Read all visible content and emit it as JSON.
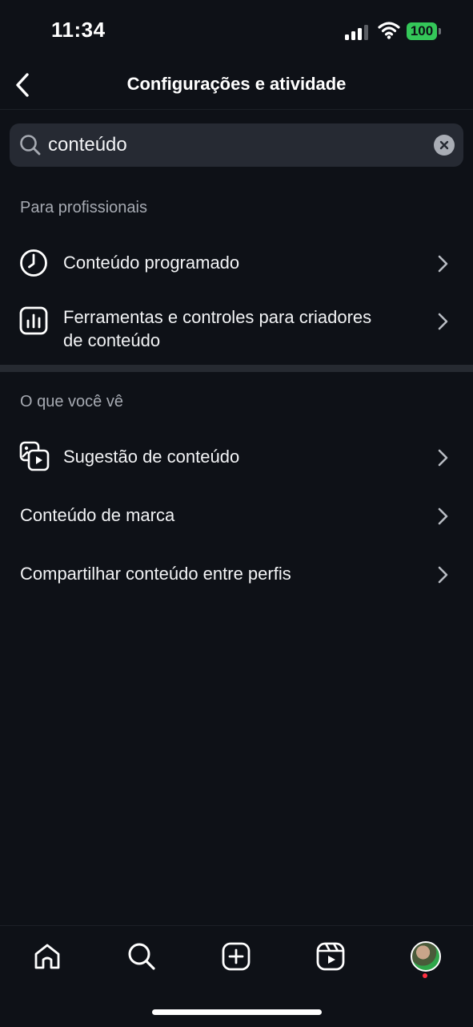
{
  "status_bar": {
    "time": "11:34",
    "battery": "100",
    "battery_color": "#34c759"
  },
  "header": {
    "title": "Configurações e atividade",
    "back_icon": "chevron-left-icon"
  },
  "search": {
    "value": "conteúdo",
    "icon": "search-icon",
    "clear_icon": "clear-icon"
  },
  "sections": {
    "professionals": {
      "title": "Para profissionais",
      "items": [
        {
          "label": "Conteúdo programado",
          "icon": "clock-icon"
        },
        {
          "label_line1": "Ferramentas e controles para criadores",
          "label_line2": "de conteúdo",
          "icon": "bar-chart-icon"
        }
      ]
    },
    "what_you_see": {
      "title": "O que você vê",
      "items": [
        {
          "label": "Sugestão de conteúdo",
          "icon": "media-suggestions-icon"
        },
        {
          "label": "Conteúdo de marca"
        },
        {
          "label": "Compartilhar conteúdo entre perfis"
        }
      ]
    }
  },
  "bottom_nav": {
    "items": [
      "home-icon",
      "search-icon",
      "create-icon",
      "reels-icon",
      "profile-avatar"
    ]
  },
  "colors": {
    "background": "#0e1117",
    "search_bg": "#262a33",
    "divider": "#262a31",
    "notification_dot": "#ff3040"
  }
}
